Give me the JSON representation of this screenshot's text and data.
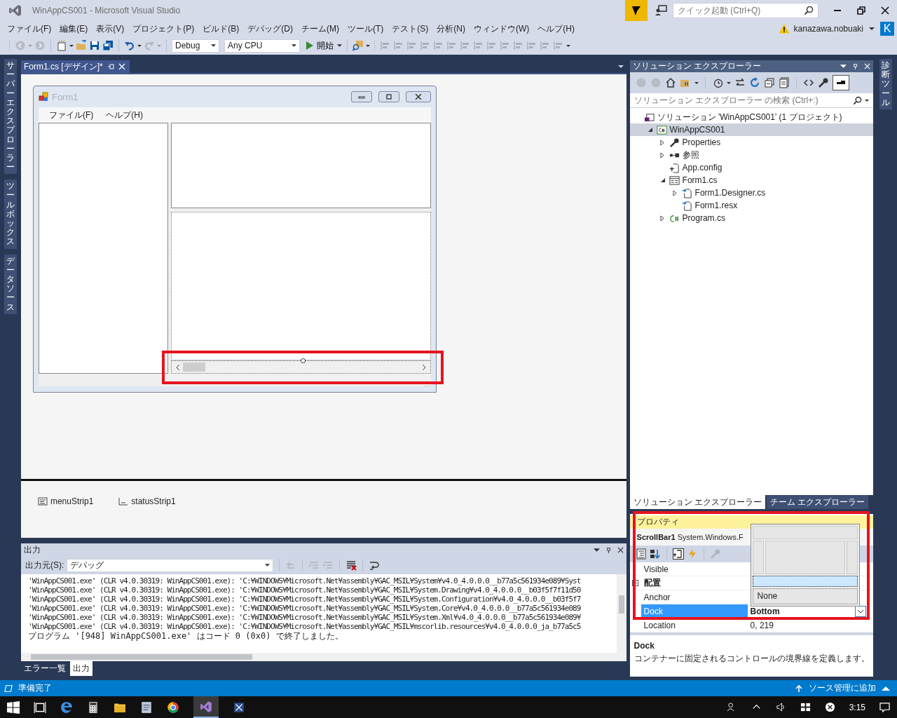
{
  "window": {
    "title": "WinAppCS001 - Microsoft Visual Studio",
    "quick_launch": {
      "placeholder": "クイック起動 (Ctrl+Q)"
    }
  },
  "menu": [
    "ファイル(F)",
    "編集(E)",
    "表示(V)",
    "プロジェクト(P)",
    "ビルド(B)",
    "デバッグ(D)",
    "チーム(M)",
    "ツール(T)",
    "テスト(S)",
    "分析(N)",
    "ウィンドウ(W)",
    "ヘルプ(H)"
  ],
  "account": {
    "user": "kanazawa.nobuaki",
    "avatar_letter": "K"
  },
  "toolbar": {
    "configuration": "Debug",
    "platform": "Any CPU",
    "start": "開始"
  },
  "left_tool_tabs": [
    "サーバーエクスプローラー",
    "ツールボックス",
    "データソース"
  ],
  "right_tool_tabs": [
    "診断ツール"
  ],
  "document_tab": {
    "title": "Form1.cs [デザイン]*"
  },
  "form_designer": {
    "title": "Form1",
    "menu": [
      "ファイル(F)",
      "ヘルプ(H)"
    ]
  },
  "component_tray": [
    {
      "kind": "menu",
      "label": "menuStrip1"
    },
    {
      "kind": "status",
      "label": "statusStrip1"
    }
  ],
  "output": {
    "title": "出力",
    "source_label": "出力元(S):",
    "source": "デバッグ",
    "lines": [
      "'WinAppCS001.exe' (CLR v4.0.30319: WinAppCS001.exe): 'C:¥WINDOWS¥Microsoft.Net¥assembly¥GAC_MSIL¥System¥v4.0_4.0.0.0__b77a5c561934e089¥Syst",
      "'WinAppCS001.exe' (CLR v4.0.30319: WinAppCS001.exe): 'C:¥WINDOWS¥Microsoft.Net¥assembly¥GAC_MSIL¥System.Drawing¥v4.0_4.0.0.0__b03f5f7f11d50",
      "'WinAppCS001.exe' (CLR v4.0.30319: WinAppCS001.exe): 'C:¥WINDOWS¥Microsoft.Net¥assembly¥GAC_MSIL¥System.Configuration¥v4.0_4.0.0.0__b03f5f7",
      "'WinAppCS001.exe' (CLR v4.0.30319: WinAppCS001.exe): 'C:¥WINDOWS¥Microsoft.Net¥assembly¥GAC_MSIL¥System.Core¥v4.0_4.0.0.0__b77a5c561934e089",
      "'WinAppCS001.exe' (CLR v4.0.30319: WinAppCS001.exe): 'C:¥WINDOWS¥Microsoft.Net¥assembly¥GAC_MSIL¥System.Xml¥v4.0_4.0.0.0__b77a5c561934e089¥",
      "'WinAppCS001.exe' (CLR v4.0.30319: WinAppCS001.exe): 'C:¥WINDOWS¥Microsoft.Net¥assembly¥GAC_MSIL¥mscorlib.resources¥v4.0_4.0.0.0_ja_b77a5c5",
      "プログラム '[948] WinAppCS001.exe' はコード 0 (0x0) で終了しました。"
    ],
    "tabs": [
      {
        "label": "エラー一覧",
        "selected": false
      },
      {
        "label": "出力",
        "selected": true
      }
    ]
  },
  "solution_explorer": {
    "title": "ソリューション エクスプローラー",
    "search": {
      "placeholder": "ソリューション エクスプローラー の検索 (Ctrl+:)"
    },
    "tree": [
      {
        "label": "ソリューション 'WinAppCS001' (1 プロジェクト)",
        "kind": "solution",
        "selected": false,
        "children": [
          {
            "label": "WinAppCS001",
            "kind": "project",
            "selected": true,
            "expanded": true,
            "children": [
              {
                "label": "Properties",
                "kind": "wrench",
                "selected": false,
                "expanded": false
              },
              {
                "label": "参照",
                "kind": "references",
                "selected": false,
                "expanded": false
              },
              {
                "label": "App.config",
                "kind": "config",
                "selected": false
              },
              {
                "label": "Form1.cs",
                "kind": "form",
                "selected": false,
                "expanded": true,
                "children": [
                  {
                    "label": "Form1.Designer.cs",
                    "kind": "file",
                    "selected": false,
                    "expanded": false
                  },
                  {
                    "label": "Form1.resx",
                    "kind": "file",
                    "selected": false
                  }
                ]
              },
              {
                "label": "Program.cs",
                "kind": "csharp",
                "selected": false,
                "expanded": false
              }
            ]
          }
        ]
      }
    ],
    "tabs": [
      {
        "label": "ソリューション エクスプローラー",
        "selected": true
      },
      {
        "label": "チーム エクスプローラー",
        "selected": false
      }
    ]
  },
  "properties": {
    "title": "プロパティ",
    "object_name": "ScrollBar1",
    "object_type": "System.Windows.F",
    "rows": [
      {
        "kind": "property",
        "name": "Visible",
        "selected": false
      },
      {
        "kind": "category",
        "name": "配置",
        "selected": false
      },
      {
        "kind": "property",
        "name": "Anchor",
        "selected": false
      },
      {
        "kind": "property",
        "name": "Dock",
        "value": "Bottom",
        "selected": true
      },
      {
        "kind": "property",
        "name": "Location",
        "value": "0, 219",
        "selected": false
      }
    ],
    "dock_picker": {
      "options": [
        {
          "kind": "top",
          "selected": false
        },
        {
          "kind": "left",
          "selected": false
        },
        {
          "kind": "fill",
          "selected": false
        },
        {
          "kind": "right",
          "selected": false
        },
        {
          "kind": "bottom",
          "selected": true
        }
      ],
      "none_label": "None"
    },
    "description": {
      "title": "Dock",
      "text": "コンテナーに固定されるコントロールの境界線を定義します。"
    }
  },
  "status_bar": {
    "text": "準備完了",
    "source_control": "ソース管理に追加"
  },
  "taskbar": {
    "time": "3:15"
  }
}
